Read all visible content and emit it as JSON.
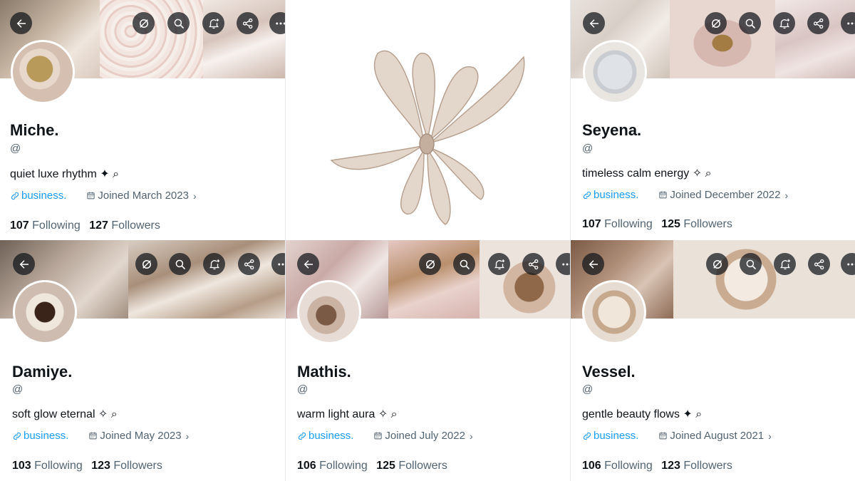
{
  "profiles": [
    {
      "id": "tl",
      "name": "Miche.",
      "handle": "@",
      "bio": "quiet luxe rhythm ✦ ⌕",
      "link": "business.",
      "joined": "Joined March 2023",
      "following_count": "107",
      "following_label": "Following",
      "followers_count": "127",
      "followers_label": "Followers"
    },
    {
      "id": "tr",
      "name": "Seyena.",
      "handle": "@",
      "bio": "timeless calm energy ✧ ⌕",
      "link": "business.",
      "joined": "Joined December 2022",
      "following_count": "107",
      "following_label": "Following",
      "followers_count": "125",
      "followers_label": "Followers"
    },
    {
      "id": "bl",
      "name": "Damiye.",
      "handle": "@",
      "bio": "soft glow eternal ✧ ⌕",
      "link": "business.",
      "joined": "Joined May 2023",
      "following_count": "103",
      "following_label": "Following",
      "followers_count": "123",
      "followers_label": "Followers"
    },
    {
      "id": "bm",
      "name": "Mathis.",
      "handle": "@",
      "bio": "warm light aura ✧ ⌕",
      "link": "business.",
      "joined": "Joined July 2022",
      "following_count": "106",
      "following_label": "Following",
      "followers_count": "125",
      "followers_label": "Followers"
    },
    {
      "id": "br",
      "name": "Vessel.",
      "handle": "@",
      "bio": "gentle beauty flows ✦ ⌕",
      "link": "business.",
      "joined": "Joined August 2021",
      "following_count": "106",
      "following_label": "Following",
      "followers_count": "123",
      "followers_label": "Followers"
    }
  ],
  "icons": {
    "back": "back-arrow-icon",
    "grok": "grok-icon",
    "search": "search-icon",
    "notify": "bell-plus-icon",
    "share": "share-icon",
    "more": "more-icon",
    "link": "link-icon",
    "calendar": "calendar-icon",
    "chevron": "chevron-right-icon",
    "bow": "ribbon-bow-illustration"
  },
  "colors": {
    "link": "#1d9bf0",
    "secondary": "#536471",
    "primary": "#0f1419",
    "button_bg": "#0f1419b8",
    "bow": "#c8b3a3"
  }
}
